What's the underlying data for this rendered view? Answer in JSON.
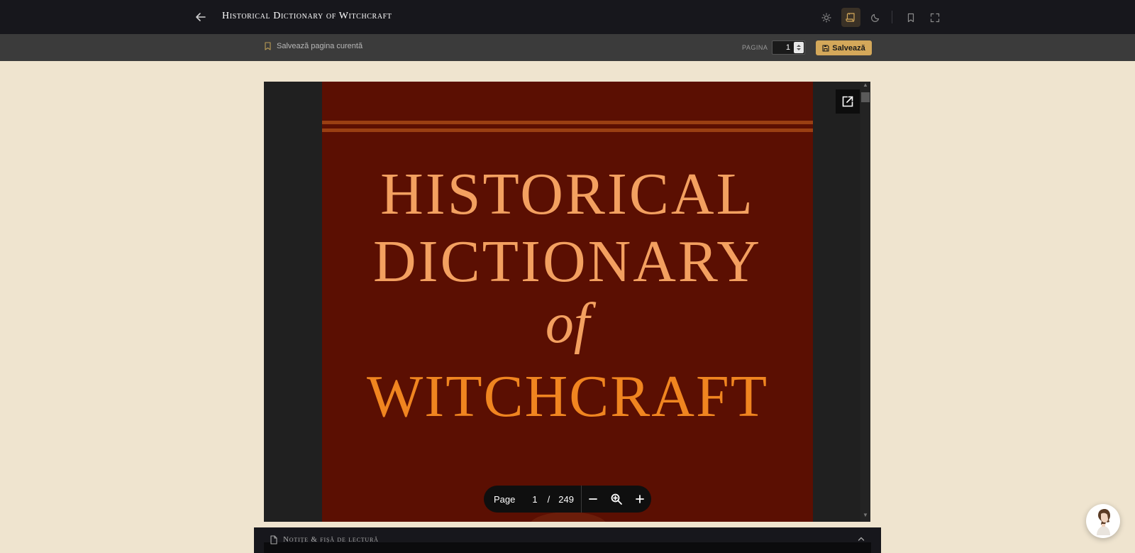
{
  "header": {
    "title": "Historical Dictionary of Witchcraft",
    "back_icon": "arrow-left-icon",
    "controls": [
      {
        "name": "light-mode",
        "icon": "sun-icon",
        "active": false
      },
      {
        "name": "sepia-mode",
        "icon": "scroll-icon",
        "active": true
      },
      {
        "name": "dark-mode",
        "icon": "moon-icon",
        "active": false
      },
      {
        "name": "bookmark",
        "icon": "bookmark-icon",
        "active": false
      },
      {
        "name": "fullscreen",
        "icon": "expand-icon",
        "active": false
      }
    ]
  },
  "subbar": {
    "save_current_label": "Salvează pagina curentă",
    "page_caption": "PAGINA",
    "page_value": "1",
    "save_label": "Salvează"
  },
  "viewer": {
    "cover_lines": [
      "HISTORICAL",
      "DICTIONARY",
      "of",
      "WITCHCRAFT"
    ],
    "pager": {
      "label": "Page",
      "current": "1",
      "separator": "/",
      "total": "249"
    }
  },
  "notes": {
    "label": "Notițe & fișă de lectură"
  },
  "colors": {
    "background": "#efe4cf",
    "topbar": "#17171c",
    "accent": "#d4a85a",
    "cover": "#5b0f02",
    "cover_text": "#f3a060",
    "cover_text_bottom": "#f08520"
  }
}
